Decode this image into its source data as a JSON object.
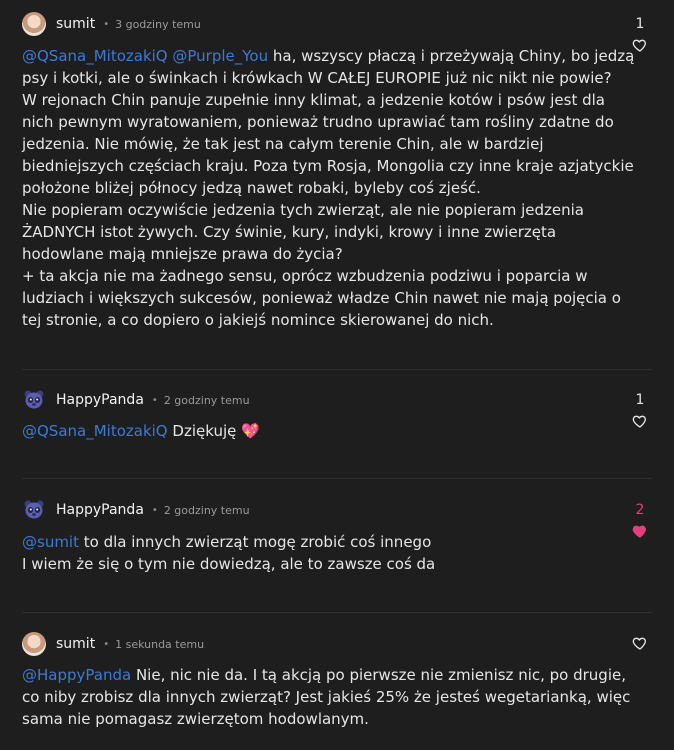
{
  "comments": [
    {
      "user": "sumit",
      "separator": "•",
      "time": "3 godziny temu",
      "likes": "1",
      "liked": false,
      "mentions": "@QSana_MitozakiQ @Purple_You",
      "text": " ha, wszyscy płaczą i przeżywają Chiny, bo jedzą psy i kotki, ale o świnkach i krówkach W CAŁEJ EUROPIE już nic nikt nie powie?\nW rejonach Chin panuje zupełnie inny klimat, a jedzenie kotów i psów jest dla nich pewnym wyratowaniem, ponieważ trudno uprawiać tam rośliny zdatne do jedzenia. Nie mówię, że tak jest na całym terenie Chin, ale w bardziej biedniejszych częściach kraju. Poza tym Rosja, Mongolia czy inne kraje azjatyckie położone bliżej północy jedzą nawet robaki, byleby coś zjeść.\nNie popieram oczywiście jedzenia tych zwierząt, ale nie popieram jedzenia ŻADNYCH istot żywych. Czy świnie, kury, indyki, krowy i inne zwierzęta hodowlane mają mniejsze prawa do życia?\n+ ta akcja nie ma żadnego sensu, oprócz wzbudzenia podziwu i poparcia w ludziach i większych sukcesów, ponieważ władze Chin nawet nie mają pojęcia o tej stronie, a co dopiero o jakiejś nomince skierowanej do nich."
    },
    {
      "user": "HappyPanda",
      "separator": "•",
      "time": "2 godziny temu",
      "likes": "1",
      "liked": false,
      "mentions": "@QSana_MitozakiQ",
      "text": " Dziękuję 💖"
    },
    {
      "user": "HappyPanda",
      "separator": "•",
      "time": "2 godziny temu",
      "likes": "2",
      "liked": true,
      "mentions": "@sumit",
      "text": " to dla innych zwierząt mogę zrobić coś innego\nI wiem że się o tym nie dowiedzą, ale to zawsze coś da"
    },
    {
      "user": "sumit",
      "separator": "•",
      "time": "1 sekunda temu",
      "likes": "",
      "liked": false,
      "mentions": "@HappyPanda",
      "text": " Nie, nic nie da. I tą akcją po pierwsze nie zmienisz nic, po drugie, co niby zrobisz dla innych zwierząt? Jest jakieś 25% że jesteś wegetarianką, więc sama nie pomagasz zwierzętom hodowlanym."
    }
  ],
  "colors": {
    "background": "#1e1e1f",
    "mention": "#3d7ad6",
    "liked": "#e73c7e"
  },
  "icons": {
    "avatar_sumit": "avatar-photo",
    "avatar_panda": "panda-avatar",
    "like": "heart-icon"
  }
}
